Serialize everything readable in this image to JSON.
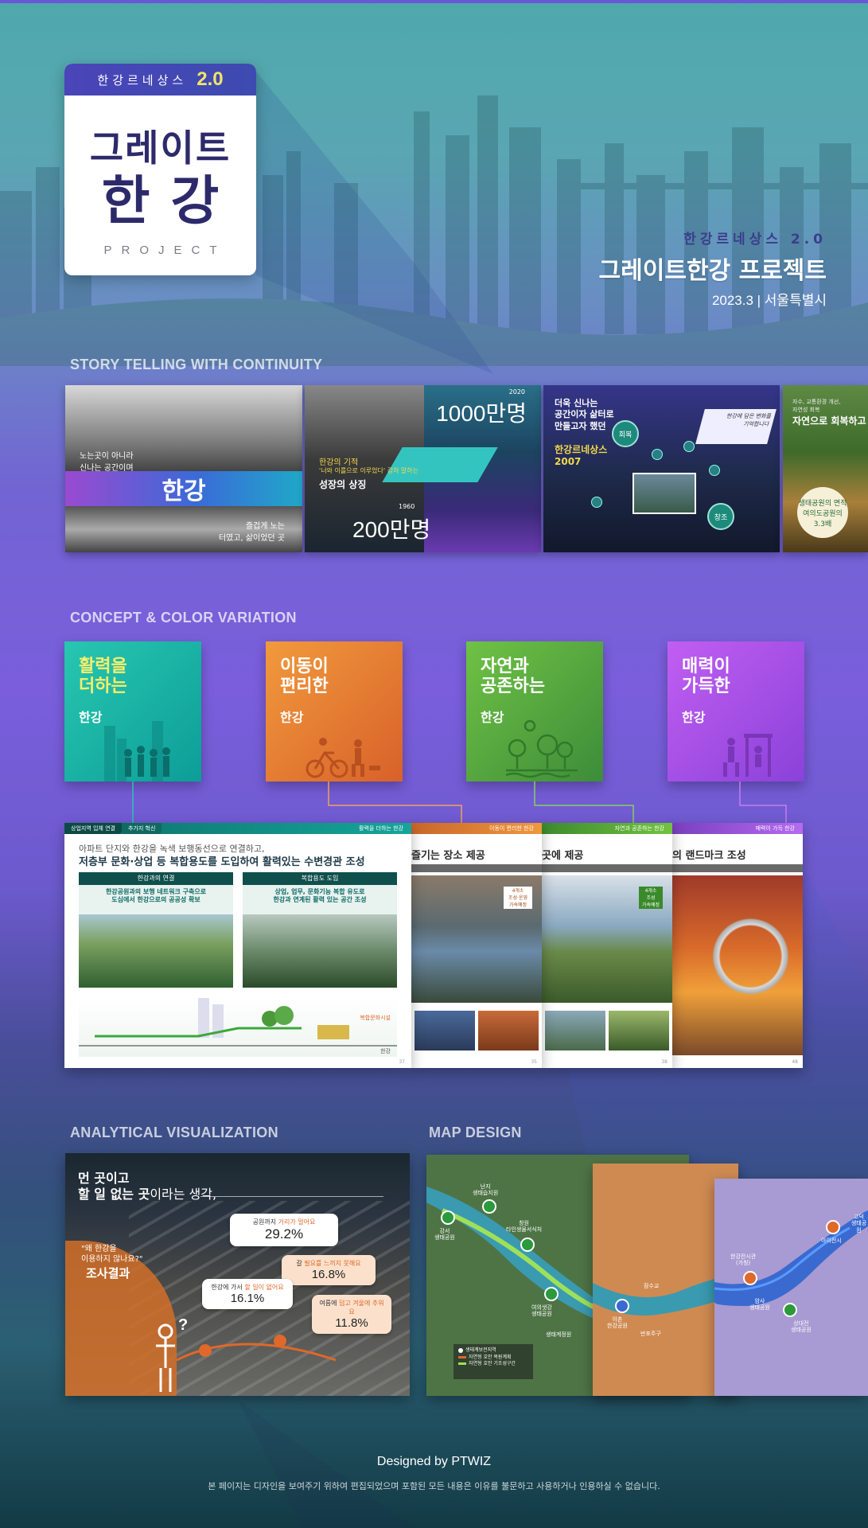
{
  "hero": {
    "badge_kicker": "한강르네상스",
    "badge_version": "2.0",
    "badge_title_line1": "그레이트",
    "badge_title_line2": "한강",
    "badge_sub": "PROJECT",
    "right_kicker": "한강르네상스 2.0",
    "right_title": "그레이트한강 프로젝트",
    "right_meta": "2023.3  |  서울특별시"
  },
  "sections": {
    "story": "STORY TELLING WITH CONTINUITY",
    "concept": "CONCEPT & COLOR VARIATION",
    "analytical": "ANALYTICAL VISUALIZATION",
    "map": "MAP DESIGN"
  },
  "story_panels": {
    "p1_caption_top": "노는곳이 아니라\n신나는 공간이며",
    "p1_band": "한강",
    "p1_caption_bottom": "즐겁게 노는\n터였고, 삶이었던 곳",
    "p2_big_top": "1000만명",
    "p2_year_top": "2020",
    "p2_tag": "한강의 기적",
    "p2_title": "성장의 상징",
    "p2_subtitle": "'너와 이를으로 이루었다' 감히 말하는",
    "p2_year_bottom": "1960",
    "p2_big_bottom": "200만명",
    "p3_title": "더욱 신나는\n공간이자 삶터로\n만들고자 했던",
    "p3_sub": "한강르네상스\n2007",
    "p3_node1": "회복",
    "p3_node2": "창조",
    "p3_card": "한강에 담은 변화를\n기억합니다",
    "p4_title": "자연으로 회복하고",
    "p4_sub": "자수, 교통환경 개선,\n자연성 회복",
    "p4_badge": "생태공원의 면적\n여의도공원의\n3.3배"
  },
  "concepts": [
    {
      "title": "활력을\n더하는",
      "sub": "한강",
      "color": "#1db3a6"
    },
    {
      "title": "이동이\n편리한",
      "sub": "한강",
      "color": "#e57f34"
    },
    {
      "title": "자연과\n공존하는",
      "sub": "한강",
      "color": "#58a83f"
    },
    {
      "title": "매력이\n가득한",
      "sub": "한강",
      "color": "#a852e6"
    }
  ],
  "slides": {
    "s1_tab1": "상업지역 입체 연결",
    "s1_tab2": "추가지 혁신",
    "s1_head": "활력을 더하는 한강",
    "s1_sub": "아파트 단지와 한강을 녹색 보행동선으로 연결하고,",
    "s1_title": "저층부 문화·상업 등 복합용도를 도입하여 활력있는 수변경관 조성",
    "s1_box1_head": "한강과의 연결",
    "s1_box1_text": "한강공원과의 보행 네트워크 구축으로\n도심에서 한강으로의 공공성 확보",
    "s1_box2_head": "복합용도 도입",
    "s1_box2_text": "상업, 업무, 문화기능 복합 유도로\n한강과 연계된 활력 있는 공간 조성",
    "s1_section_label": "복합문화시설",
    "s1_section_label2": "한강",
    "s1_page": "37",
    "s2_head": "이동이 편리한 한강",
    "s2_title": "즐기는 장소 제공",
    "s2_badge": "4개소\n조성·운영\n가속예정",
    "s2_page": "35",
    "s3_head": "자연과 공존하는 한강",
    "s3_title": "곳에 제공",
    "s3_badge": "4개소\n조성\n가속예정",
    "s3_page": "38",
    "s4_head": "매력이 가득 한강",
    "s4_title": "의 랜드마크 조성",
    "s4_page": "48"
  },
  "analytical": {
    "headline_line1": "먼 곳이고",
    "headline_bold": "할 일 없는 곳",
    "headline_rest": "이라는 생각,",
    "question": "\"왜 한강을\n이용하지 않나요?\"",
    "result": "조사결과",
    "bubbles": [
      {
        "label_prefix": "공원까지 ",
        "label_hl": "거리가 멀어요",
        "value": "29.2%"
      },
      {
        "label_prefix": "갈 ",
        "label_hl": "필요를 느끼지 못해요",
        "value": "16.8%"
      },
      {
        "label_prefix": "한강에 가서 ",
        "label_hl": "할 일이 없어요",
        "value": "16.1%"
      },
      {
        "label_prefix": "여름에 ",
        "label_hl": "덥고 겨울에 추워요",
        "value": "11.8%"
      }
    ]
  },
  "maps": {
    "m1_labels": [
      "강서\n생태공원",
      "난지\n생태습지원",
      "창원\n타인생물서식처",
      "여의샛강\n생태공원",
      "생태계정원"
    ],
    "m1_legend": [
      "생태계보전지역",
      "자연형 호안 복원계획",
      "자연형 호안 기조성구간"
    ],
    "m2_labels": [
      "잠수교",
      "반포주구",
      "이촌\n한강공원"
    ],
    "m3_labels": [
      "한강전시관\n(가칭)",
      "아이전시",
      "고덕\n생태공원",
      "암사\n생태공원",
      "상대전\n생태공원"
    ]
  },
  "footer": {
    "credit": "Designed by PTWIZ",
    "note": "본 페이지는 디자인을 보여주기 위하여 편집되었으며 포함된 모든 내용은 이유를 불문하고 사용하거나 인용하실 수 없습니다."
  }
}
